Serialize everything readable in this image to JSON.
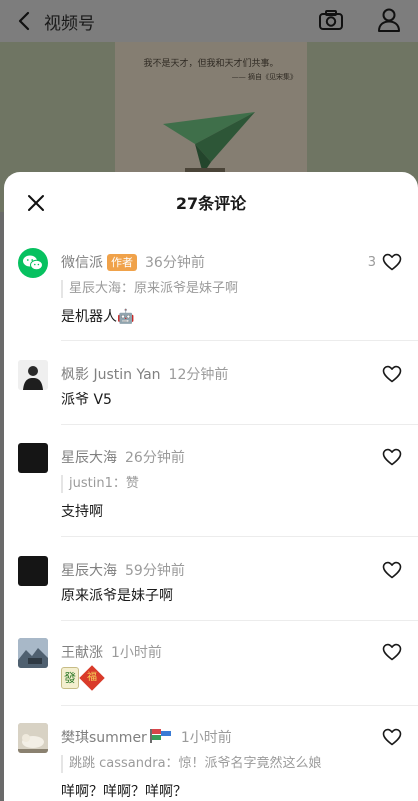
{
  "header": {
    "title": "视频号",
    "back_icon": "chevron-left-icon",
    "camera_icon": "camera-icon",
    "profile_icon": "person-icon"
  },
  "video": {
    "quote": "我不是天才，但我和天才们共事。",
    "source": "—— 摘自《见宋集》"
  },
  "sheet": {
    "title": "27条评论",
    "close_icon": "close-icon"
  },
  "comments": [
    {
      "name": "微信派",
      "badge": "作者",
      "time": "36分钟前",
      "reply": "星辰大海：原来派爷是妹子啊",
      "text": "是机器人",
      "emoji": "🤖",
      "likes": "3",
      "avatar": "wechat-logo"
    },
    {
      "name": "枫影 Justin Yan",
      "time": "12分钟前",
      "text": "派爷 V5",
      "avatar": "person-photo"
    },
    {
      "name": "星辰大海",
      "time": "26分钟前",
      "reply": "justin1：赞",
      "text": "支持啊",
      "avatar": "dark-photo"
    },
    {
      "name": "星辰大海",
      "time": "59分钟前",
      "text": "原来派爷是妹子啊",
      "avatar": "dark-photo"
    },
    {
      "name": "王献涨",
      "time": "1小时前",
      "text_emojis": [
        "發",
        "福"
      ],
      "avatar": "landscape-photo"
    },
    {
      "name": "樊琪summer",
      "time": "1小时前",
      "reply": "跳跳 cassandra：惊！派爷名字竟然这么娘",
      "text": "咩啊？咩啊？咩啊？",
      "avatar": "animal-photo"
    }
  ],
  "colors": {
    "author_badge": "#f0a24a",
    "wechat_green": "#07c160",
    "text_primary": "#1a1a1a",
    "text_secondary": "#808080"
  }
}
